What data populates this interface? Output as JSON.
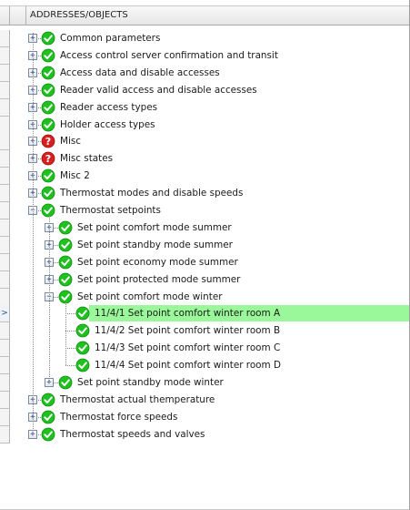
{
  "header": {
    "column_title": "ADDRESSES/OBJECTS"
  },
  "current_row_marker": ">",
  "tree": {
    "items": [
      {
        "label": "Common parameters",
        "status": "ok",
        "expander": "+"
      },
      {
        "label": "Access control server confirmation and transit",
        "status": "ok",
        "expander": "+"
      },
      {
        "label": "Access data and disable accesses",
        "status": "ok",
        "expander": "+"
      },
      {
        "label": "Reader valid access and disable accesses",
        "status": "ok",
        "expander": "+"
      },
      {
        "label": "Reader access types",
        "status": "ok",
        "expander": "+"
      },
      {
        "label": "Holder access types",
        "status": "ok",
        "expander": "+"
      },
      {
        "label": "Misc",
        "status": "error",
        "expander": "+"
      },
      {
        "label": "Misc states",
        "status": "error",
        "expander": "+"
      },
      {
        "label": "Misc 2",
        "status": "ok",
        "expander": "+"
      },
      {
        "label": "Thermostat modes and disable speeds",
        "status": "ok",
        "expander": "+"
      },
      {
        "label": "Thermostat setpoints",
        "status": "ok",
        "expander": "−"
      },
      {
        "label": "Set point comfort mode summer",
        "status": "ok",
        "expander": "+"
      },
      {
        "label": "Set point standby mode summer",
        "status": "ok",
        "expander": "+"
      },
      {
        "label": "Set point economy mode summer",
        "status": "ok",
        "expander": "+"
      },
      {
        "label": "Set point protected mode summer",
        "status": "ok",
        "expander": "+"
      },
      {
        "label": "Set point comfort mode winter",
        "status": "ok",
        "expander": "−"
      },
      {
        "label": "11/4/1 Set point comfort winter room A",
        "status": "ok",
        "expander": ""
      },
      {
        "label": "11/4/2 Set point comfort winter room B",
        "status": "ok",
        "expander": ""
      },
      {
        "label": "11/4/3 Set point comfort winter room C",
        "status": "ok",
        "expander": ""
      },
      {
        "label": "11/4/4 Set point comfort winter room D",
        "status": "ok",
        "expander": ""
      },
      {
        "label": "Set point standby mode winter",
        "status": "ok",
        "expander": "+"
      },
      {
        "label": "Thermostat actual themperature",
        "status": "ok",
        "expander": "+"
      },
      {
        "label": "Thermostat force speeds",
        "status": "ok",
        "expander": "+"
      },
      {
        "label": "Thermostat speeds and valves",
        "status": "ok",
        "expander": "+"
      }
    ]
  },
  "colors": {
    "ok": "#1fc11f",
    "error": "#d81f1f",
    "selected_row": "#9bf89a"
  }
}
